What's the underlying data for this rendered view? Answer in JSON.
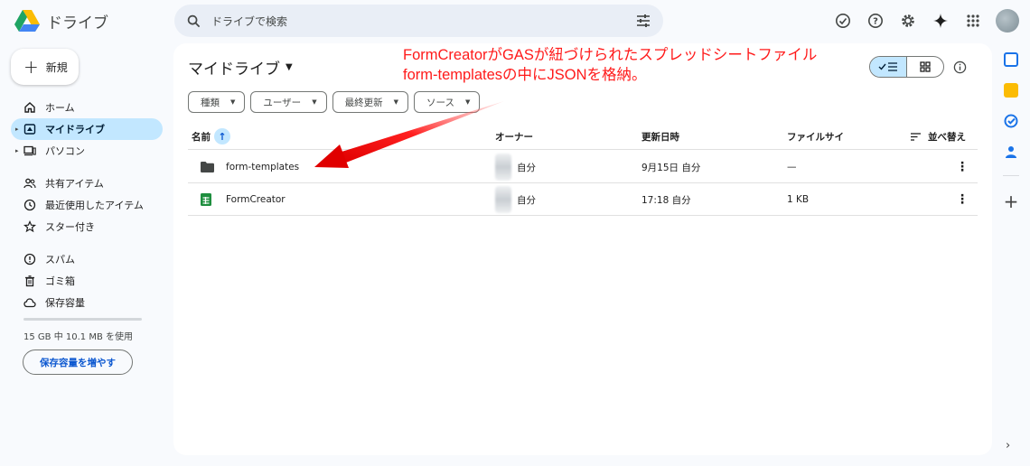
{
  "app": {
    "name": "ドライブ"
  },
  "search": {
    "placeholder": "ドライブで検索"
  },
  "nav": {
    "new_label": "新規",
    "items": [
      {
        "label": "ホーム"
      },
      {
        "label": "マイドライブ"
      },
      {
        "label": "パソコン"
      },
      {
        "label": "共有アイテム"
      },
      {
        "label": "最近使用したアイテム"
      },
      {
        "label": "スター付き"
      },
      {
        "label": "スパム"
      },
      {
        "label": "ゴミ箱"
      },
      {
        "label": "保存容量"
      }
    ],
    "storage_text": "15 GB 中 10.1 MB を使用",
    "storage_used_fraction": 0.0007,
    "storage_button": "保存容量を増やす"
  },
  "main": {
    "title": "マイドライブ",
    "filters": [
      "種類",
      "ユーザー",
      "最終更新",
      "ソース"
    ],
    "columns": {
      "name": "名前",
      "owner": "オーナー",
      "modified": "更新日時",
      "size": "ファイルサイ",
      "sort": "並べ替え"
    },
    "rows": [
      {
        "name": "form-templates",
        "type": "folder",
        "owner": "自分",
        "modified": "9月15日 自分",
        "size": "—"
      },
      {
        "name": "FormCreator",
        "type": "sheet",
        "owner": "自分",
        "modified": "17:18 自分",
        "size": "1 KB"
      }
    ]
  },
  "annotation": {
    "line1": "FormCreatorがGASが紐づけられたスプレッドシートファイル",
    "line2": "form-templatesの中にJSONを格納。"
  },
  "colors": {
    "accent": "#0b57d0",
    "selected": "#c2e7ff",
    "annotation": "#ff1a1a",
    "sheets_green": "#1e8e3e"
  }
}
